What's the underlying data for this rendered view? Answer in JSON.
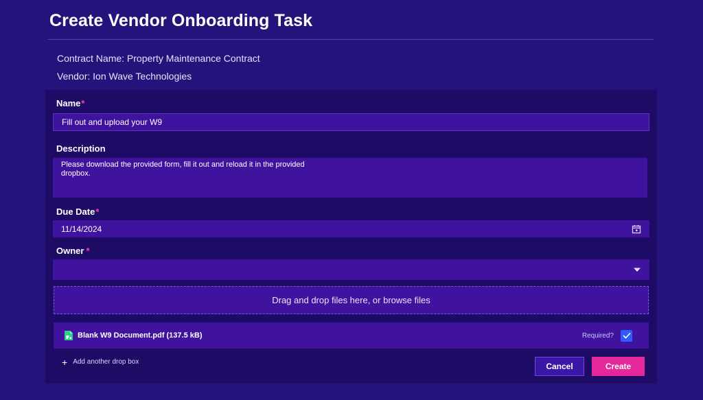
{
  "page": {
    "title": "Create Vendor Onboarding Task",
    "contract_name": "Contract Name: Property Maintenance Contract",
    "vendor": "Vendor: Ion Wave Technologies"
  },
  "form": {
    "name": {
      "label": "Name",
      "required_mark": "*",
      "value": "Fill out and upload your W9"
    },
    "description": {
      "label": "Description",
      "value": "Please download the provided form, fill it out and reload it in the provided dropbox."
    },
    "due_date": {
      "label": "Due Date",
      "required_mark": "*",
      "value": "11/14/2024",
      "icon": "calendar-icon"
    },
    "owner": {
      "label": "Owner",
      "required_mark": "*",
      "value": "",
      "icon": "chevron-down-icon"
    },
    "dropzone": {
      "text": "Drag and drop files here, or browse files"
    },
    "file": {
      "name": "Blank W9 Document.pdf",
      "size": "(137.5 kB)",
      "icon": "pdf-file-icon",
      "required_label": "Required?",
      "required_checked": true
    },
    "add_drop_box": {
      "icon": "plus-icon",
      "label": "Add another drop box"
    },
    "buttons": {
      "cancel": "Cancel",
      "create": "Create"
    }
  },
  "colors": {
    "background": "#23137a",
    "panel": "#1d0b66",
    "input": "#3f139e",
    "required_star": "#ff3fa6",
    "checkbox": "#2f5bff",
    "create_button": "#e5279c"
  }
}
